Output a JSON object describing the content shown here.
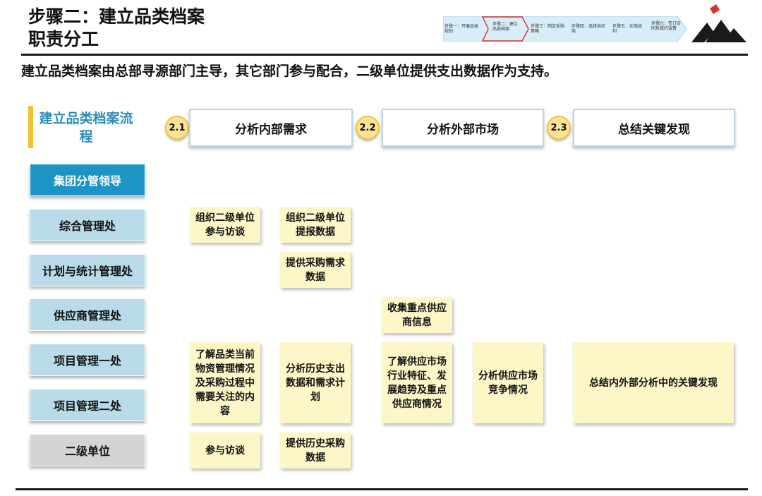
{
  "header": {
    "title_line1": "步骤二：建立品类档案",
    "title_line2": "职责分工",
    "subtitle": "建立品类档案由总部寻源部门主导，其它部门参与配合，二级单位提供支出数据作为支持。"
  },
  "steps_nav": {
    "steps": [
      "步骤一：开展品类规划",
      "步骤二：建立品类档案",
      "步骤三：制定采购策略",
      "步骤四：选择供应商",
      "步骤五：实施谈判",
      "步骤六：签订合同及履约监督"
    ],
    "active_index": 1,
    "colors": {
      "arrow_fill": "#d7eef8",
      "active_outline": "#d0342c"
    }
  },
  "flow_title": "建立品类档案流程",
  "phases": [
    {
      "number": "2.1",
      "label": "分析内部需求"
    },
    {
      "number": "2.2",
      "label": "分析外部市场"
    },
    {
      "number": "2.3",
      "label": "总结关键发现"
    }
  ],
  "roles": [
    {
      "label": "集团分管领导",
      "style": "dark"
    },
    {
      "label": "综合管理处",
      "style": "light"
    },
    {
      "label": "计划与统计管理处",
      "style": "light"
    },
    {
      "label": "供应商管理处",
      "style": "light"
    },
    {
      "label": "项目管理一处",
      "style": "light"
    },
    {
      "label": "项目管理二处",
      "style": "light"
    },
    {
      "label": "二级单位",
      "style": "grey"
    }
  ],
  "tasks": [
    {
      "text": "组织二级单位参与访谈"
    },
    {
      "text": "组织二级单位提报数据"
    },
    {
      "text": "提供采购需求数据"
    },
    {
      "text": "收集重点供应商信息"
    },
    {
      "text": "了解品类当前物资管理情况及采购过程中需要关注的内容"
    },
    {
      "text": "分析历史支出数据和需求计划"
    },
    {
      "text": "了解供应市场行业特征、发展趋势及重点供应商情况"
    },
    {
      "text": "分析供应市场竞争情况"
    },
    {
      "text": "总结内外部分析中的关键发现"
    },
    {
      "text": "参与访谈"
    },
    {
      "text": "提供历史采购数据"
    }
  ],
  "colors": {
    "accent_blue": "#1c94c6",
    "role_light": "#b8dae9",
    "task_fill": "#fdf7c8",
    "badge_fill": "#fbe398",
    "side_bar": "#f2c230"
  }
}
